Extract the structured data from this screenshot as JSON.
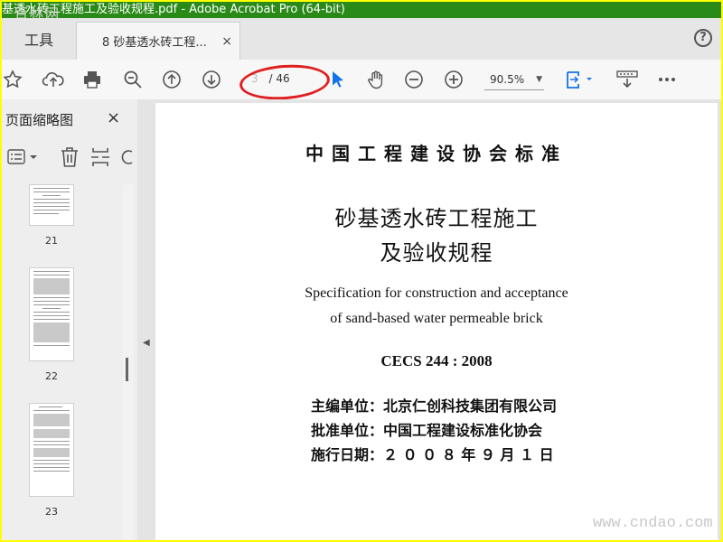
{
  "window": {
    "title": "基透水砖工程施工及验收规程.pdf - Adobe Acrobat Pro (64-bit)"
  },
  "watermark_top": "百林网",
  "tabs": {
    "tools_label": "工具",
    "doc_tab_label": "8 砂基透水砖工程...",
    "close_glyph": "×",
    "help_glyph": "?"
  },
  "toolbar": {
    "page_current": "3",
    "page_total": "/ 46",
    "zoom_value": "90.5%",
    "icons": [
      "bookmark-star-icon",
      "upload-cloud-icon",
      "print-icon",
      "zoom-out-search-icon",
      "page-up-icon",
      "page-down-icon",
      "select-cursor-icon",
      "hand-icon",
      "zoom-minus-icon",
      "zoom-plus-icon",
      "fit-page-icon",
      "scroll-mode-icon",
      "more-icon"
    ]
  },
  "sidebar": {
    "title": "页面缩略图",
    "thumbnails": [
      {
        "page_label": "21"
      },
      {
        "page_label": "22"
      },
      {
        "page_label": "23"
      }
    ]
  },
  "document": {
    "org": "中国工程建设协会标准",
    "title_line1": "砂基透水砖工程施工",
    "title_line2": "及验收规程",
    "en_line1": "Specification for construction and acceptance",
    "en_line2": "of sand-based water permeable brick",
    "code": "CECS 244 : 2008",
    "editor": "主编单位：北京仁创科技集团有限公司",
    "approver": "批准单位：中国工程建设标准化协会",
    "effective": "施行日期：２ ０ ０ ８ 年 ９ 月 １ 日"
  },
  "watermark_bottom": "www.cndao.com",
  "colors": {
    "titlebar": "#2a8a18",
    "frame_border": "#ffff00",
    "annotation_ring": "#e02020",
    "select_tool": "#1473e6"
  }
}
